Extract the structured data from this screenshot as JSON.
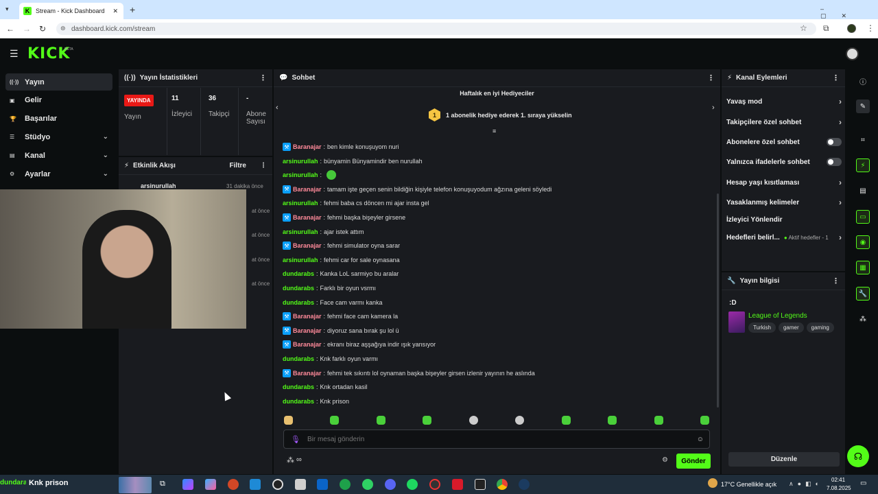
{
  "browser": {
    "tab_title": "Stream - Kick Dashboard",
    "url": "dashboard.kick.com/stream",
    "new_tab": "+",
    "close": "✕"
  },
  "header": {
    "logo": "KICK",
    "beta": "BETA"
  },
  "sidebar": {
    "items": [
      {
        "label": "Yayın",
        "icon": "broadcast-icon",
        "glyph": "((·))",
        "active": true
      },
      {
        "label": "Gelir",
        "icon": "wallet-icon",
        "glyph": "▣"
      },
      {
        "label": "Başarılar",
        "icon": "trophy-icon",
        "glyph": "🏆"
      },
      {
        "label": "Stüdyo",
        "icon": "studio-icon",
        "glyph": "☰",
        "expand": true
      },
      {
        "label": "Kanal",
        "icon": "channel-icon",
        "glyph": "▤",
        "expand": true
      },
      {
        "label": "Ayarlar",
        "icon": "gear-icon",
        "glyph": "⚙",
        "expand": true
      }
    ]
  },
  "stats": {
    "title": "Yayın İstatistikleri",
    "live_badge": "YAYINDA",
    "stream_label": "Yayın",
    "viewers_value": "11",
    "viewers_label": "İzleyici",
    "followers_value": "36",
    "followers_label": "Takipçi",
    "subs_value": "-",
    "subs_label": "Abone Sayısı"
  },
  "activity": {
    "title": "Etkinlik Akışı",
    "filter": "Filtre",
    "first_user": "arsinurullah",
    "first_time": "31 dakika önce",
    "partial_times": [
      "at önce",
      "at önce",
      "at önce",
      "at önce"
    ]
  },
  "chat": {
    "title": "Sohbet",
    "gifters_title": "Haftalık en iyi Hediyeciler",
    "gifters_rank": "1",
    "gifters_text": "1 abonelik hediye ederek 1. sıraya yükselin",
    "messages": [
      {
        "user": "Baranajar",
        "mod": true,
        "text": "ben kimle konuşuyom nuri"
      },
      {
        "user": "arsinurullah",
        "mod": false,
        "text": "bünyamin Bünyamindir ben nurullah"
      },
      {
        "user": "arsinurullah",
        "mod": false,
        "text": "",
        "emote": true
      },
      {
        "user": "Baranajar",
        "mod": true,
        "text": "tamam işte geçen senin bildiğin kişiyle telefon konuşuyodum ağzına geleni söyledi"
      },
      {
        "user": "arsinurullah",
        "mod": false,
        "text": "fehmi baba cs döncen mi ajar insta gel"
      },
      {
        "user": "Baranajar",
        "mod": true,
        "text": "fehmi başka bişeyler girsene"
      },
      {
        "user": "arsinurullah",
        "mod": false,
        "text": "ajar istek attım"
      },
      {
        "user": "Baranajar",
        "mod": true,
        "text": "fehmi simulator oyna sarar"
      },
      {
        "user": "arsinurullah",
        "mod": false,
        "text": "fehmi car for sale oynasana"
      },
      {
        "user": "dundarabs",
        "mod": false,
        "text": "Kanka LoL sarmiyo bu aralar"
      },
      {
        "user": "dundarabs",
        "mod": false,
        "text": "Farklı bir oyun vsrmı"
      },
      {
        "user": "dundarabs",
        "mod": false,
        "text": "Face cam varmı kanka"
      },
      {
        "user": "Baranajar",
        "mod": true,
        "text": "fehmi face cam kamera la"
      },
      {
        "user": "Baranajar",
        "mod": true,
        "text": "diyoruz sana bırak şu lol ü"
      },
      {
        "user": "Baranajar",
        "mod": true,
        "text": "ekranı biraz aşşağıya indir ışık yansıyor"
      },
      {
        "user": "dundarabs",
        "mod": false,
        "text": "Knk farklı oyun varmı"
      },
      {
        "user": "Baranajar",
        "mod": true,
        "text": "fehmi tek sıkıntı lol oynaman başka bişeyler girsen izlenir yayının he aslında"
      },
      {
        "user": "dundarabs",
        "mod": false,
        "text": "Knk ortadan kasil"
      },
      {
        "user": "dundarabs",
        "mod": false,
        "text": "Knk prison"
      }
    ],
    "input_placeholder": "Bir mesaj gönderin",
    "send_label": "Gönder",
    "infinity": "∞"
  },
  "actions": {
    "title": "Kanal Eylemleri",
    "items": [
      {
        "label": "Yavaş mod",
        "kind": "chev"
      },
      {
        "label": "Takipçilere özel sohbet",
        "kind": "chev"
      },
      {
        "label": "Abonelere özel sohbet",
        "kind": "toggle"
      },
      {
        "label": "Yalnızca ifadelerle sohbet",
        "kind": "toggle"
      },
      {
        "label": "Hesap yaşı kısıtlaması",
        "kind": "chev"
      },
      {
        "label": "Yasaklanmış kelimeler",
        "kind": "chev"
      },
      {
        "label": "İzleyici Yönlendir",
        "kind": "none"
      },
      {
        "label": "Hedefleri belirl...",
        "kind": "chev",
        "extra": "Aktif hedefler - 1"
      }
    ]
  },
  "stream_info": {
    "title": "Yayın bilgisi",
    "stream_title": ":D",
    "category": "League of Legends",
    "tags": [
      "Turkish",
      "gamer",
      "gaming"
    ],
    "edit_label": "Düzenle"
  },
  "taskbar": {
    "overlay_user": "dundarabs",
    "overlay_msg": "Knk prison",
    "weather": "17°C  Genellikle açık",
    "time": "02:41",
    "date": "7.08.2025"
  },
  "colors": {
    "accent": "#53fc18",
    "live": "#e91916",
    "mod_badge": "#0a9ffa",
    "panel": "#191b1f",
    "bg": "#0b0e0f"
  }
}
